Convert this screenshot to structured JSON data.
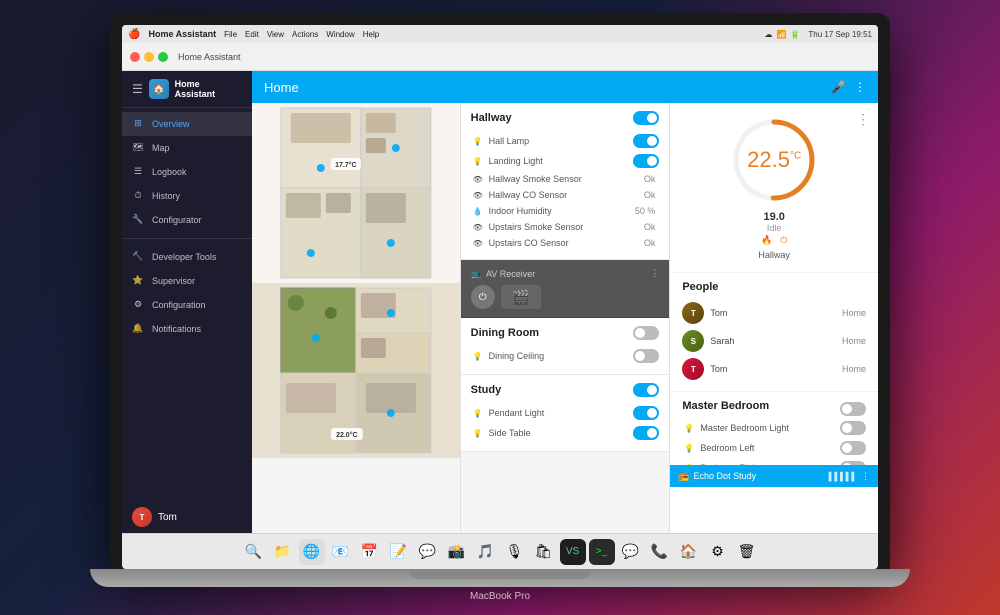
{
  "laptop": {
    "model": "MacBook Pro"
  },
  "macos": {
    "menubar": {
      "apple": "🍎",
      "app": "Home Assistant",
      "menu_items": [
        "File",
        "Edit",
        "View",
        "Actions",
        "Window",
        "Help"
      ],
      "right_items": [
        "Thu 17 Sep",
        "19:51"
      ]
    },
    "dock": {
      "items": [
        "🔍",
        "🗑️",
        "📁",
        "🌐",
        "📧",
        "📅",
        "🎵",
        "📷",
        "💻",
        "🎛️",
        "⚙️",
        "🔔"
      ]
    }
  },
  "ha": {
    "app_name": "Home Assistant",
    "page_title": "Home",
    "sidebar": {
      "items": [
        {
          "icon": "⊞",
          "label": "Overview",
          "active": true
        },
        {
          "icon": "🗺",
          "label": "Map"
        },
        {
          "icon": "☰",
          "label": "Logbook"
        },
        {
          "icon": "⏱",
          "label": "History"
        },
        {
          "icon": "🔧",
          "label": "Configurator"
        }
      ],
      "bottom_items": [
        {
          "icon": "🔨",
          "label": "Developer Tools"
        },
        {
          "icon": "⭐",
          "label": "Supervisor"
        },
        {
          "icon": "⚙",
          "label": "Configuration"
        },
        {
          "icon": "🔔",
          "label": "Notifications"
        }
      ],
      "user": "Tom"
    },
    "hallway": {
      "title": "Hallway",
      "entities": [
        {
          "icon": "💡",
          "name": "Hall Lamp",
          "value": "",
          "type": "toggle_on"
        },
        {
          "icon": "💡",
          "name": "Landing Light",
          "value": "",
          "type": "toggle_on"
        },
        {
          "icon": "👁",
          "name": "Hallway Smoke Sensor",
          "value": "Ok",
          "type": "text"
        },
        {
          "icon": "👁",
          "name": "Hallway CO Sensor",
          "value": "Ok",
          "type": "text"
        },
        {
          "icon": "💧",
          "name": "Indoor Humidity",
          "value": "50 %",
          "type": "text"
        },
        {
          "icon": "👁",
          "name": "Upstairs Smoke Sensor",
          "value": "Ok",
          "type": "text"
        },
        {
          "icon": "👁",
          "name": "Upstairs CO Sensor",
          "value": "Ok",
          "type": "text"
        }
      ]
    },
    "thermostat": {
      "temperature": "22.5",
      "unit": "°C",
      "target": "19.0",
      "status": "Idle",
      "name": "Hallway"
    },
    "people": {
      "title": "People",
      "list": [
        {
          "name": "Tom",
          "status": "Home",
          "color": "#8B4513"
        },
        {
          "name": "Sarah",
          "status": "Home",
          "color": "#6B8E23"
        },
        {
          "name": "Tom",
          "status": "Home",
          "color": "#DC143C"
        }
      ]
    },
    "av_receiver": {
      "title": "AV Receiver",
      "icon": "📺"
    },
    "dining_room": {
      "title": "Dining Room",
      "entities": [
        {
          "icon": "💡",
          "name": "Dining Ceiling",
          "value": "",
          "type": "toggle_off"
        }
      ]
    },
    "study": {
      "title": "Study",
      "entities": [
        {
          "icon": "💡",
          "name": "Pendant Light",
          "value": "",
          "type": "toggle_on"
        },
        {
          "icon": "💡",
          "name": "Side Table",
          "value": "",
          "type": "toggle_on"
        }
      ]
    },
    "master_bedroom": {
      "title": "Master Bedroom",
      "entities": [
        {
          "icon": "💡",
          "name": "Master Bedroom Light",
          "value": "",
          "type": "toggle_off"
        },
        {
          "icon": "💡",
          "name": "Bedroom Left",
          "value": "",
          "type": "toggle_off"
        },
        {
          "icon": "💡",
          "name": "Bedroom Right",
          "value": "",
          "type": "toggle_off"
        }
      ]
    },
    "echo_dot": {
      "title": "Echo Dot Study",
      "color": "#03a9f4"
    },
    "floorplan": {
      "top_temp": "17.7°C",
      "bottom_temp": "22.0°C"
    }
  }
}
